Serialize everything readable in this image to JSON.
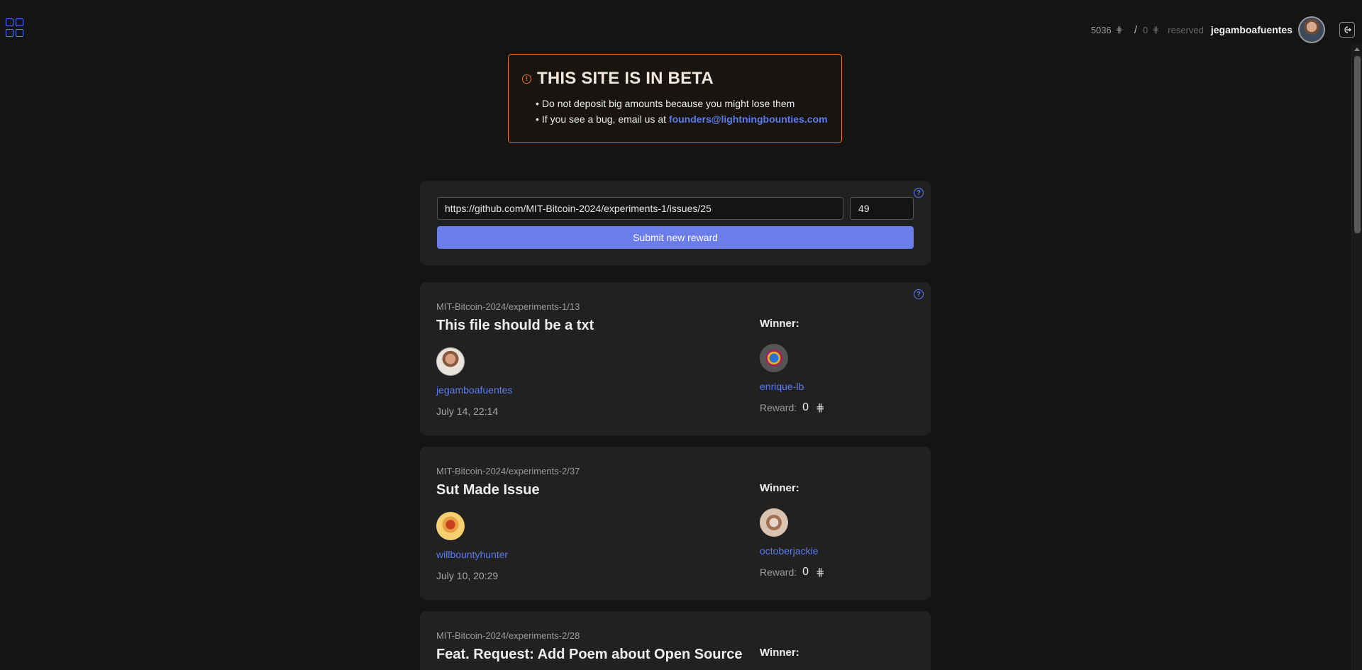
{
  "header": {
    "balance": "5036",
    "reserved_amount": "0",
    "reserved_label": "reserved",
    "username": "jegamboafuentes",
    "sat_symbol": "⋕",
    "slash": "/"
  },
  "beta_notice": {
    "title": "THIS SITE IS IN BETA",
    "line1": "Do not deposit big amounts because you might lose them",
    "line2_prefix": "If you see a bug, email us at ",
    "email": "founders@lightningbounties.com"
  },
  "submit_form": {
    "url_value": "https://github.com/MIT-Bitcoin-2024/experiments-1/issues/25",
    "amount_value": "49",
    "submit_label": "Submit new reward",
    "help": "?"
  },
  "issues": [
    {
      "repo": "MIT-Bitcoin-2024/experiments-1/13",
      "title": "This file should be a txt",
      "creator": "jegamboafuentes",
      "date": "July 14, 22:14",
      "winner_label": "Winner:",
      "winner": "enrique-lb",
      "reward_label": "Reward:",
      "reward_value": "0"
    },
    {
      "repo": "MIT-Bitcoin-2024/experiments-2/37",
      "title": "Sut Made Issue",
      "creator": "willbountyhunter",
      "date": "July 10, 20:29",
      "winner_label": "Winner:",
      "winner": "octoberjackie",
      "reward_label": "Reward:",
      "reward_value": "0"
    },
    {
      "repo": "MIT-Bitcoin-2024/experiments-2/28",
      "title": "Feat. Request: Add Poem about Open Source",
      "winner_label": "Winner:"
    }
  ],
  "colors": {
    "accent": "#5b7bf0",
    "warning": "#e07a2a",
    "button": "#6a7de8",
    "background": "#141414",
    "card": "#212121"
  }
}
